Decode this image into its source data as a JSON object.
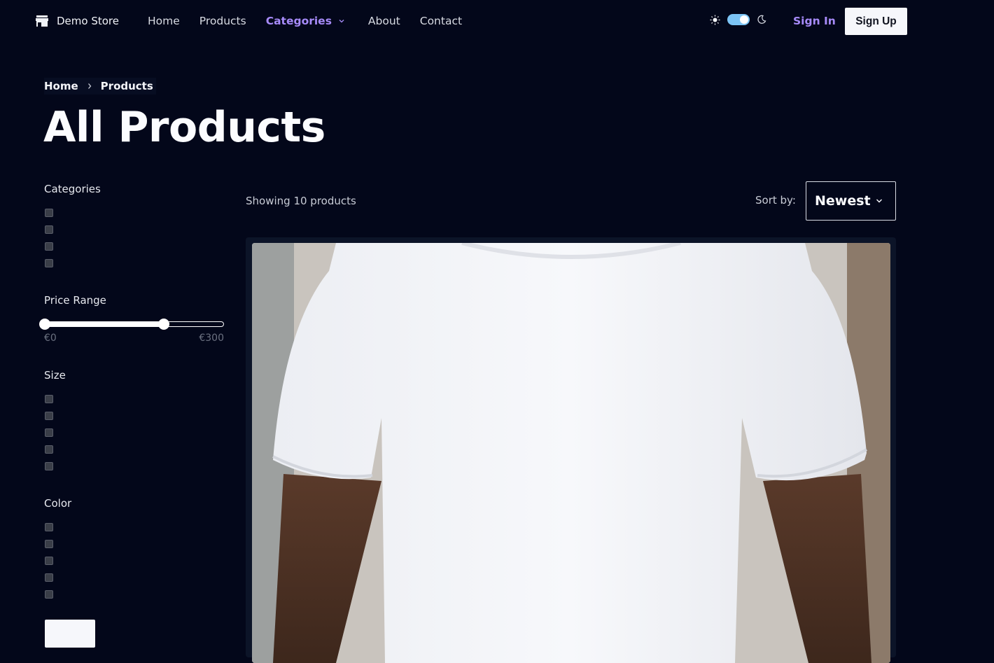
{
  "header": {
    "brand": "Demo Store",
    "nav": [
      "Home",
      "Products",
      "Categories",
      "About",
      "Contact"
    ],
    "active_nav": "Categories",
    "sign_in": "Sign In",
    "sign_up": "Sign Up",
    "theme_toggle": "on",
    "accent": "#a78bfa"
  },
  "breadcrumb": [
    "Home",
    "Products"
  ],
  "page_title": "All Products",
  "filters": {
    "categories_title": "Categories",
    "categories_count": 4,
    "price_title": "Price Range",
    "price_min_label": "€0",
    "price_max_label": "€300",
    "price_range": [
      0,
      200
    ],
    "size_title": "Size",
    "size_count": 5,
    "color_title": "Color",
    "color_count": 5
  },
  "toolbar": {
    "showing": "Showing 10 products",
    "sort_label": "Sort by:",
    "sort_value": "Newest"
  },
  "product": {
    "image": "white-tshirt-photo"
  },
  "icons": [
    "store-icon",
    "chevron-down-icon",
    "sun-icon",
    "moon-icon",
    "chevron-right-icon"
  ]
}
